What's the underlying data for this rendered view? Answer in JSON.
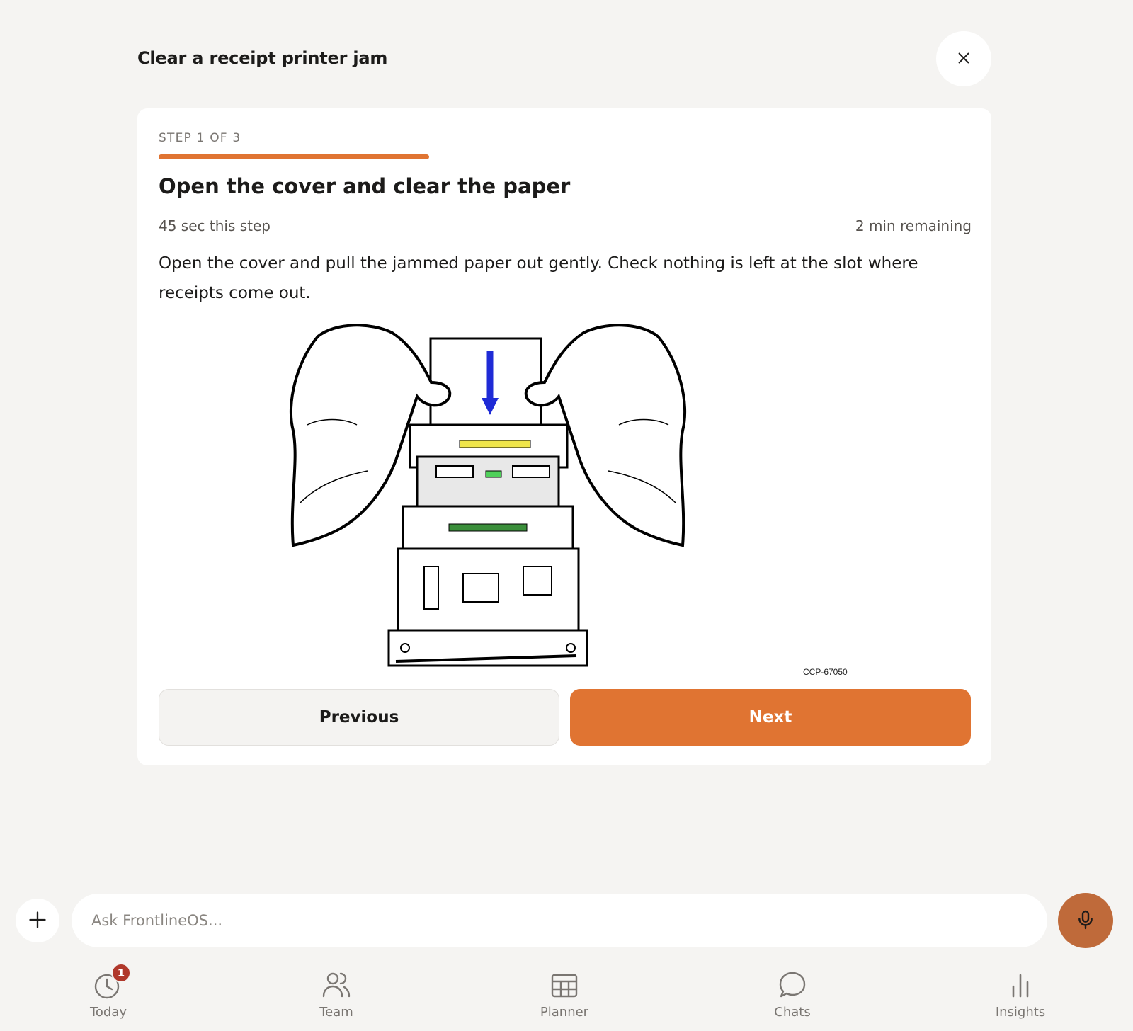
{
  "header": {
    "title": "Clear a receipt printer jam",
    "close_icon": "close-icon"
  },
  "step": {
    "label": "STEP 1 OF 3",
    "progress": 0.333,
    "title": "Open the cover and clear the paper",
    "duration": "45 sec this step",
    "remaining": "2 min remaining",
    "body": "Open the cover and pull the jammed paper out gently. Check nothing is left at the slot where receipts come out.",
    "figure_code": "CCP-67050",
    "previous_label": "Previous",
    "next_label": "Next"
  },
  "composer": {
    "add_icon": "plus-icon",
    "placeholder": "Ask FrontlineOS...",
    "mic_icon": "microphone-icon"
  },
  "nav": {
    "items": [
      {
        "label": "Today",
        "icon": "clock-icon",
        "badge": "1"
      },
      {
        "label": "Team",
        "icon": "people-icon"
      },
      {
        "label": "Planner",
        "icon": "calendar-icon"
      },
      {
        "label": "Chats",
        "icon": "chat-bubble-icon"
      },
      {
        "label": "Insights",
        "icon": "bar-chart-icon"
      }
    ]
  },
  "colors": {
    "accent": "#e07432",
    "mic": "#bf6a3a",
    "badge": "#b0382b",
    "background": "#f5f4f2"
  }
}
